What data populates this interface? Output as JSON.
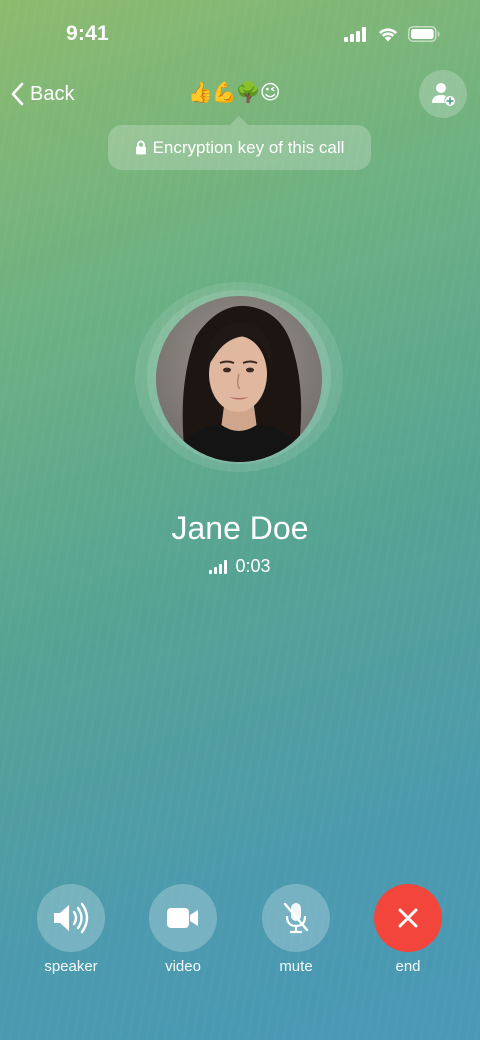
{
  "status_bar": {
    "time": "9:41",
    "icons": [
      "cellular-signal-icon",
      "wifi-icon",
      "battery-icon"
    ]
  },
  "header": {
    "back_label": "Back",
    "emoji_key": "👍💪🌳😉",
    "add_participant_icon": "add-user-icon"
  },
  "tooltip": {
    "text": "Encryption key of this call",
    "icon": "lock-icon"
  },
  "caller": {
    "name": "Jane Doe",
    "duration": "0:03",
    "connection_quality_bars": 4
  },
  "controls": [
    {
      "label": "speaker",
      "icon": "speaker-icon"
    },
    {
      "label": "video",
      "icon": "video-camera-icon"
    },
    {
      "label": "mute",
      "icon": "microphone-muted-icon"
    },
    {
      "label": "end",
      "icon": "close-icon",
      "color": "#f2453c"
    }
  ]
}
